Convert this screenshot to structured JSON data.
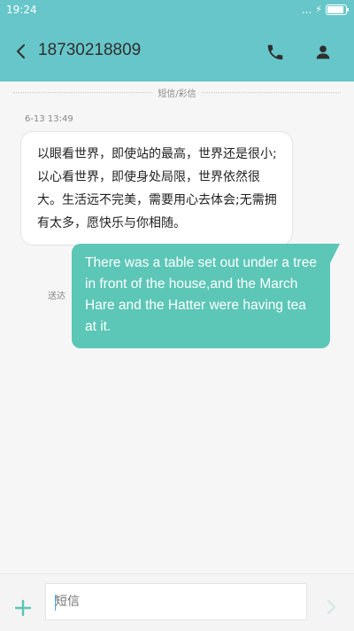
{
  "status_bar": {
    "time": "19:24",
    "signal_dots": "..."
  },
  "header": {
    "title": "18730218809"
  },
  "thread": {
    "divider_label": "短信/彩信",
    "incoming": {
      "timestamp": "6-13 13:49",
      "text": "以眼看世界，即使站的最高，世界还是很小;以心看世界，即使身处局限，世界依然很大。生活远不完美，需要用心去体会;无需拥有太多，愿快乐与你相随。"
    },
    "outgoing": {
      "text": "There was a table set out under a tree in front of the house,and the March Hare and the Hatter were having tea at it.",
      "status": "送达"
    }
  },
  "composer": {
    "placeholder": "短信"
  },
  "colors": {
    "header": "#67c6c9",
    "outgoing_bubble": "#5cc6b7",
    "background": "#f6f6f6"
  }
}
